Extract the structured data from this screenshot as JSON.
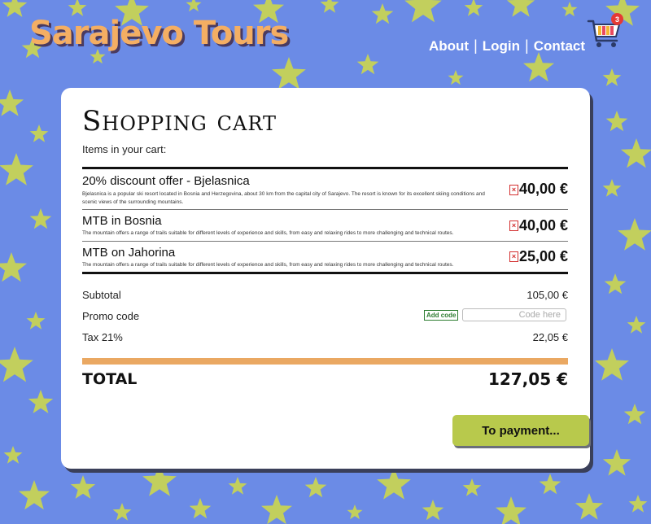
{
  "brand": "Sarajevo Tours",
  "nav": {
    "about": "About",
    "login": "Login",
    "contact": "Contact",
    "separator": "|"
  },
  "cart": {
    "count": "3"
  },
  "page": {
    "title": "Shopping cart",
    "subtitle": "Items in your cart:"
  },
  "items": [
    {
      "name": "20% discount offer - Bjelasnica",
      "description": "Bjelasnica is a popular ski resort located in Bosnia and Herzegovina, about 30 km from the capital city of Sarajevo. The resort is known for its excellent skiing conditions and scenic views of the surrounding mountains.",
      "price": "40,00 €",
      "remove": "×"
    },
    {
      "name": "MTB in Bosnia",
      "description": "The mountain offers a range of trails suitable for different levels of experience and skills, from easy and relaxing rides to more challenging and technical routes.",
      "price": "40,00 €",
      "remove": "×"
    },
    {
      "name": "MTB on Jahorina",
      "description": "The mountain offers a range of trails suitable for different levels of experience and skills, from easy and relaxing rides to more challenging and technical routes.",
      "price": "25,00 €",
      "remove": "×"
    }
  ],
  "summary": {
    "subtotal_label": "Subtotal",
    "subtotal_value": "105,00 €",
    "promo_label": "Promo code",
    "add_code": "Add code",
    "code_placeholder": "Code here",
    "tax_label": "Tax 21%",
    "tax_value": "22,05 €",
    "total_label": "TOTAL",
    "total_value": "127,05 €"
  },
  "payment_button": "To payment...",
  "colors": {
    "background": "#6b8be6",
    "stars": "#c2cf5d",
    "brand": "#f4ae63",
    "accent_bar": "#eaa862",
    "button": "#b8c94c"
  }
}
